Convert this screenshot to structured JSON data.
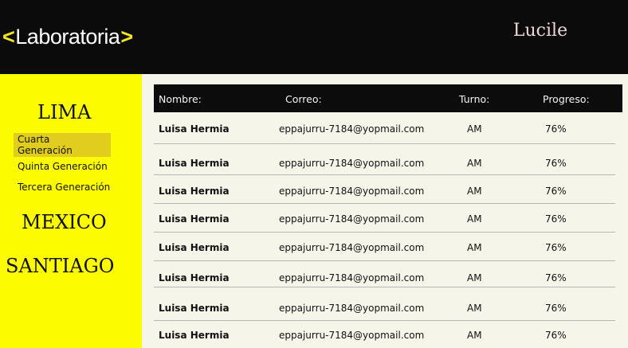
{
  "header": {
    "logo_left": "<",
    "logo_text": "Laboratoria",
    "logo_right": ">",
    "user_name": "Lucile"
  },
  "sidebar": {
    "cities": [
      "LIMA",
      "MEXICO",
      "SANTIAGO"
    ],
    "generations": [
      "Cuarta Generación",
      "Quinta Generación",
      "Tercera Generación"
    ],
    "active_generation": "Cuarta Generación"
  },
  "table": {
    "columns": [
      "Nombre:",
      "Correo:",
      "Turno:",
      "Progreso:"
    ],
    "rows": [
      {
        "name": "Luisa Hermia",
        "email": "eppajurru-7184@yopmail.com",
        "turn": "AM",
        "progress": "76%"
      },
      {
        "name": "Luisa Hermia",
        "email": "eppajurru-7184@yopmail.com",
        "turn": "AM",
        "progress": "76%"
      },
      {
        "name": "Luisa Hermia",
        "email": "eppajurru-7184@yopmail.com",
        "turn": "AM",
        "progress": "76%"
      },
      {
        "name": "Luisa Hermia",
        "email": "eppajurru-7184@yopmail.com",
        "turn": "AM",
        "progress": "76%"
      },
      {
        "name": "Luisa Hermia",
        "email": "eppajurru-7184@yopmail.com",
        "turn": "AM",
        "progress": "76%"
      },
      {
        "name": "Luisa Hermia",
        "email": "eppajurru-7184@yopmail.com",
        "turn": "AM",
        "progress": "76%"
      },
      {
        "name": "Luisa Hermia",
        "email": "eppajurru-7184@yopmail.com",
        "turn": "AM",
        "progress": "76%"
      },
      {
        "name": "Luisa Hermia",
        "email": "eppajurru-7184@yopmail.com",
        "turn": "AM",
        "progress": "76%"
      }
    ]
  },
  "colors": {
    "header_bg": "#0c0b0b",
    "sidebar_bg": "#fdfb00",
    "active_gen_bg": "#e1cd1d",
    "content_bg": "#f6f5ea",
    "logo_bracket": "#f2e81e"
  }
}
